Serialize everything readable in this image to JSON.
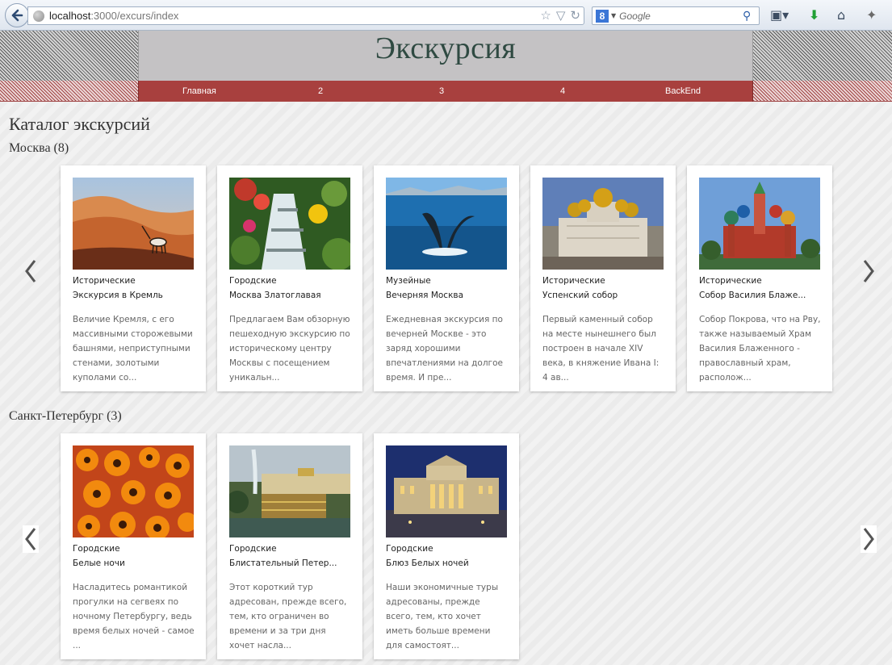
{
  "browser": {
    "url_host": "localhost",
    "url_path": ":3000/excurs/index",
    "search_placeholder": "Google",
    "search_engine_letter": "8"
  },
  "site": {
    "title": "Экскурсия",
    "nav": [
      "Главная",
      "2",
      "3",
      "4",
      "BackEnd"
    ]
  },
  "page": {
    "heading": "Каталог экскурсий"
  },
  "sections": [
    {
      "title": "Москва (8)",
      "cards": [
        {
          "category": "Исторические",
          "title": "Экскурсия в Кремль",
          "description": "Величие Кремля, с его массивными сторожевыми башнями, неприступными стенами, золотыми куполами со...",
          "image": "desert-oryx"
        },
        {
          "category": "Городские",
          "title": "Москва Златоглавая",
          "description": "Предлагаем Вам обзорную пешеходную экскурсию по историческому центру Москвы с посещением уникальн...",
          "image": "waterfall-flowers"
        },
        {
          "category": "Музейные",
          "title": "Вечерняя Москва",
          "description": "Ежедневная экскурсия по вечерней Москве - это заряд хорошими впечатлениями на долгое время. И пре...",
          "image": "whale-tail"
        },
        {
          "category": "Исторические",
          "title": "Успенский собор",
          "description": "Первый каменный собор на месте нынешнего был построен в начале XIV века, в княжение Ивана I: 4 ав...",
          "image": "cathedral"
        },
        {
          "category": "Исторические",
          "title": "Собор Василия Блаже...",
          "description": "Собор Покрова, что на Рву, также называемый Храм Василия Блаженного - православный храм, располож...",
          "image": "st-basil"
        }
      ]
    },
    {
      "title": "Санкт-Петербург (3)",
      "cards": [
        {
          "category": "Городские",
          "title": "Белые ночи",
          "description": "Насладитесь романтикой прогулки на сегвеях по ночному Петербургу, ведь время белых ночей - самое ...",
          "image": "orange-flowers"
        },
        {
          "category": "Городские",
          "title": "Блистательный Петер...",
          "description": "Этот короткий тур адресован, прежде всего, тем, кто ограничен во времени и за три дня хочет насла...",
          "image": "peterhof"
        },
        {
          "category": "Городские",
          "title": "Блюз Белых ночей",
          "description": "Наши экономичные туры адресованы, прежде всего, тем, кто хочет иметь больше времени для самостоят...",
          "image": "palace-night"
        }
      ]
    }
  ],
  "icons": {
    "back": "back-arrow-icon",
    "prev": "chevron-left-icon",
    "next": "chevron-right-icon"
  },
  "colors": {
    "nav_bg": "#a8403e",
    "title": "#2f4a42",
    "header_bg": "#c4c2c4"
  }
}
